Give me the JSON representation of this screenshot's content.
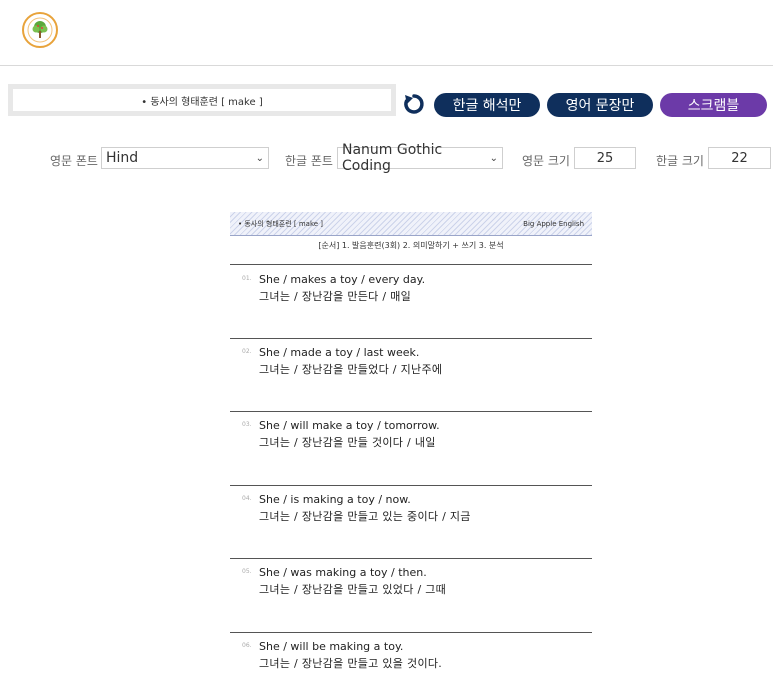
{
  "header": {
    "logo_icon": "big-apple-english-tree-logo"
  },
  "title_box": {
    "text": "• 동사의 형태훈련 [ make ]"
  },
  "actions": {
    "reload_icon": "reload-icon",
    "buttons": [
      {
        "label": "한글 해석만"
      },
      {
        "label": "영어 문장만"
      },
      {
        "label": "스크램블"
      }
    ]
  },
  "settings": {
    "english_font_label": "영문 폰트",
    "english_font_value": "Hind",
    "korean_font_label": "한글 폰트",
    "korean_font_value": "Nanum Gothic Coding",
    "english_size_label": "영문 크기",
    "english_size_value": "25",
    "korean_size_label": "한글 크기",
    "korean_size_value": "22"
  },
  "sheet": {
    "header_left": "• 동사의 형태훈련 [ make ]",
    "header_right": "Big Apple English",
    "order": "[순서] 1. 발음훈련(3회) 2. 의미말하기 + 쓰기 3. 분석",
    "items": [
      {
        "num": "01.",
        "en": "She / makes a toy / every day.",
        "ko": "그녀는 / 장난감을 만든다 / 매일"
      },
      {
        "num": "02.",
        "en": "She / made a toy / last week.",
        "ko": "그녀는 / 장난감을 만들었다 / 지난주에"
      },
      {
        "num": "03.",
        "en": "She / will make a toy / tomorrow.",
        "ko": "그녀는 / 장난감을 만들 것이다 / 내일"
      },
      {
        "num": "04.",
        "en": "She / is making a toy / now.",
        "ko": "그녀는 / 장난감을 만들고 있는 중이다 / 지금"
      },
      {
        "num": "05.",
        "en": "She / was making a toy / then.",
        "ko": "그녀는 / 장난감을 만들고 있었다 / 그때"
      },
      {
        "num": "06.",
        "en": "She / will be making a toy.",
        "ko": "그녀는 / 장난감을 만들고 있을 것이다."
      }
    ]
  }
}
